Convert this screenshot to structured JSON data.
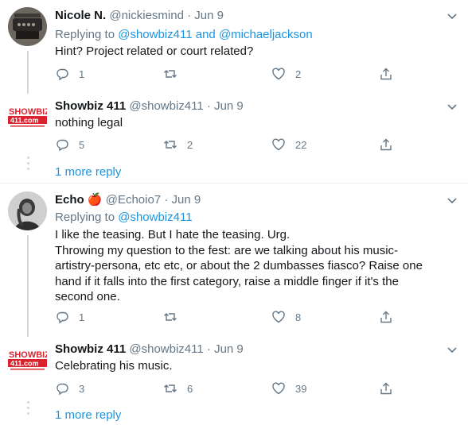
{
  "tweets": [
    {
      "name": "Nicole N.",
      "handle": "@nickiesmind",
      "sep": "·",
      "date": "Jun 9",
      "replying_prefix": "Replying to",
      "mentions": [
        "@showbiz411",
        "@michaeljackson"
      ],
      "mention_joiner": "and",
      "text": "Hint? Project related or court related?",
      "replies": "1",
      "retweets": "",
      "likes": "2"
    },
    {
      "name": "Showbiz 411",
      "handle": "@showbiz411",
      "sep": "·",
      "date": "Jun 9",
      "text": "nothing legal",
      "replies": "5",
      "retweets": "2",
      "likes": "22",
      "more_replies": "1 more reply"
    },
    {
      "name": "Echo",
      "emoji": "🍎",
      "handle": "@Echoio7",
      "sep": "·",
      "date": "Jun 9",
      "replying_prefix": "Replying to",
      "mentions": [
        "@showbiz411"
      ],
      "text_lines": [
        "I like the teasing. But I hate the teasing. Urg.",
        "Throwing my question to the fest: are we talking about his music-",
        "artistry-persona, etc etc, or about the 2 dumbasses fiasco? Raise one",
        "hand if it falls into the first category, raise a middle finger if it's the",
        "second one."
      ],
      "replies": "1",
      "retweets": "",
      "likes": "8"
    },
    {
      "name": "Showbiz 411",
      "handle": "@showbiz411",
      "sep": "·",
      "date": "Jun 9",
      "text": "Celebrating his music.",
      "replies": "3",
      "retweets": "6",
      "likes": "39",
      "more_replies": "1 more reply"
    }
  ],
  "logo": {
    "top": "SHOWBIZ",
    "bottom": "411.com"
  },
  "colors": {
    "accent": "#1b95e0",
    "muted": "#657786",
    "logo_red": "#d9232e"
  }
}
